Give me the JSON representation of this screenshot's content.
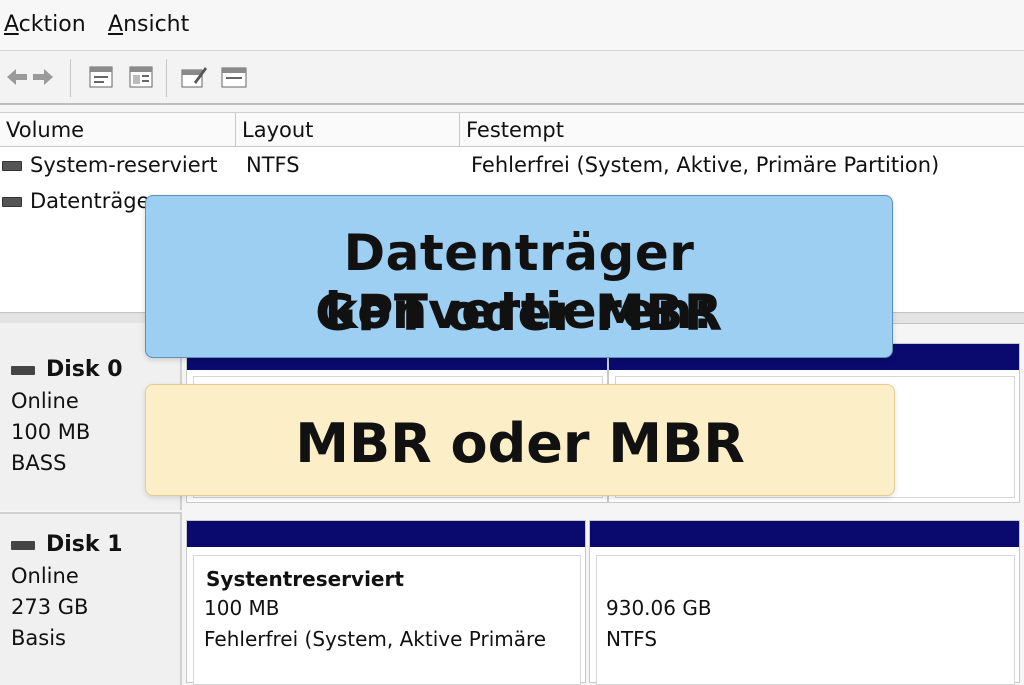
{
  "menu": {
    "items": [
      {
        "label_first": "A",
        "label_rest": "cktion"
      },
      {
        "label_first": "A",
        "label_rest": "nsicht"
      }
    ]
  },
  "toolbar": {
    "icons": [
      "back-arrow-icon",
      "forward-arrow-icon",
      "properties-icon",
      "help-icon",
      "edit-icon",
      "view-icon"
    ]
  },
  "volume_list": {
    "columns": [
      "Volume",
      "Layout",
      "Festempt"
    ],
    "rows": [
      {
        "volume": "System-reserviert",
        "layout": "NTFS",
        "status": "Fehlerfrei (System, Aktive, Primäre Partition)"
      },
      {
        "volume": "Datenträger",
        "layout": "",
        "status": ""
      }
    ]
  },
  "disks": [
    {
      "name": "Disk 0",
      "state": "Online",
      "size": "100 MB",
      "type": "BASS"
    },
    {
      "name": "Disk 1",
      "state": "Online",
      "size": "273 GB",
      "type": "Basis"
    }
  ],
  "disk1_partitions": [
    {
      "name": "Systentreserviert",
      "size": "100 MB",
      "status": "Fehlerfrei (System, Aktive Primäre"
    },
    {
      "name": "",
      "size": "930.06 GB",
      "status": "NTFS"
    }
  ],
  "overlay": {
    "title_line1": "Datenträger konvertieren:",
    "title_line2": "GPT oder MBR",
    "subtitle": "MBR oder MBR"
  },
  "colors": {
    "partition_bar": "#0a0a6e",
    "banner_blue": "#9ccff1",
    "banner_yellow": "#fcefc7"
  }
}
